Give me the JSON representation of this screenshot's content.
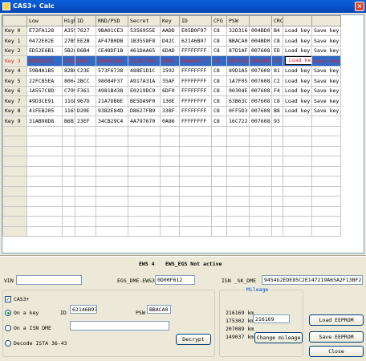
{
  "window": {
    "title": "CAS3+ Calc",
    "close_glyph": "×"
  },
  "grid": {
    "headers": [
      "",
      "Low",
      "High",
      "ID",
      "RND/PSD",
      "Secret",
      "Key",
      "ID",
      "CFG",
      "PSW",
      "",
      "CRC",
      "",
      ""
    ],
    "rows": [
      [
        "Key 0",
        "E72FA128",
        "A355",
        "7627",
        "9BA01CE3",
        "5356955E",
        "AADD",
        "E05B0F97",
        "C8",
        "32D316",
        "004BD0",
        "B4",
        "Load key",
        "Save key"
      ],
      [
        "Key 1",
        "0472E02E",
        "27B5",
        "EE2B",
        "AF47B0DB",
        "1B35S8F8",
        "D42C",
        "62146B97",
        "C8",
        "BBACA0",
        "004BD0",
        "C8",
        "Load key",
        "Save key"
      ],
      [
        "Key 2",
        "ED52E6B1",
        "5B28",
        "D6B4",
        "CE48DF1B",
        "461DAA65",
        "6DAD",
        "FFFFFFFF",
        "C8",
        "87D1AF",
        "007608",
        "ED",
        "Load key",
        "Save key"
      ],
      [
        "Key 3",
        "B89EDD7C",
        "7DE8",
        "DB31",
        "6D04C89A",
        "3C2A77A9",
        "D09C",
        "D4A60C77",
        "C8",
        "6B7F2B",
        "004BD0",
        "F8",
        "Load key",
        "Save key"
      ],
      [
        "Key 4",
        "59B4A1B5",
        "82B0",
        "C23E",
        "573F6738",
        "488E1D1C",
        "1592",
        "FFFFFFFF",
        "C8",
        "89D1A5",
        "007608",
        "81",
        "Load key",
        "Save key"
      ],
      [
        "Key 5",
        "22FCB5EA",
        "8064",
        "2BCC",
        "98084F37",
        "A917A31A",
        "35AF",
        "FFFFFFFF",
        "C8",
        "1A7F05",
        "007608",
        "C2",
        "Load key",
        "Save key"
      ],
      [
        "Key 6",
        "1A557C8D",
        "C799",
        "F361",
        "4981B438",
        "E0219DC9",
        "6DF0",
        "FFFFFFFF",
        "C8",
        "90304E",
        "007608",
        "F4",
        "Load key",
        "Save key"
      ],
      [
        "Key 7",
        "49D3CE91",
        "11GD",
        "967D",
        "21A7DB8E",
        "BE5DA9F0",
        "130E",
        "FFFFFFFF",
        "C8",
        "63B63C",
        "007608",
        "C8",
        "Load key",
        "Save key"
      ],
      [
        "Key 8",
        "41FEB205",
        "1165",
        "D20E",
        "93B2E84D",
        "D8627FB9",
        "338F",
        "FFFFFFFF",
        "C8",
        "0FF5D3",
        "007608",
        "B8",
        "Load key",
        "Save key"
      ],
      [
        "Key 9",
        "31AB98D8",
        "B6B7",
        "23EF",
        "34CB29C4",
        "4A797670",
        "0A86",
        "FFFFFFFF",
        "C8",
        "16C722",
        "007608",
        "93",
        "",
        ""
      ]
    ],
    "empty_row_count": 11
  },
  "bottom": {
    "ews_label": "EWS 4",
    "ews_status": "EWS_EGS Not active",
    "vin_label": "VIN",
    "vin_value": "",
    "egs_label": "EGS_DME-EWS3",
    "egs_value": "0D00F612",
    "isn_label": "ISN _SK_DME",
    "isn_value": "9454G2EDE85C2E147219A65A2F13BF2E",
    "cas_group": {
      "cas3plus_label": "CAS3+",
      "cas3plus_checked": true,
      "on_key_label": "On a key",
      "id_label": "ID",
      "id_value": "62146B97",
      "psw_label": "PSW",
      "psw_value": "BBACA0",
      "on_isn_label": "On a ISN DME",
      "on_isn_value": "",
      "decode_label": "Decode ISTA 36-43",
      "decrypt_button": "Decrypt",
      "check_glyph": "✓"
    },
    "mileage": {
      "title": "Mileage",
      "values": [
        "216169 km",
        "175302 km",
        "207089 km",
        "149037 km"
      ],
      "input_value": "216169",
      "change_button": "Change mileage"
    },
    "buttons": {
      "load_eeprom": "Load EEPROM",
      "save_eeprom": "Save EEPROM",
      "close": "Close"
    }
  }
}
